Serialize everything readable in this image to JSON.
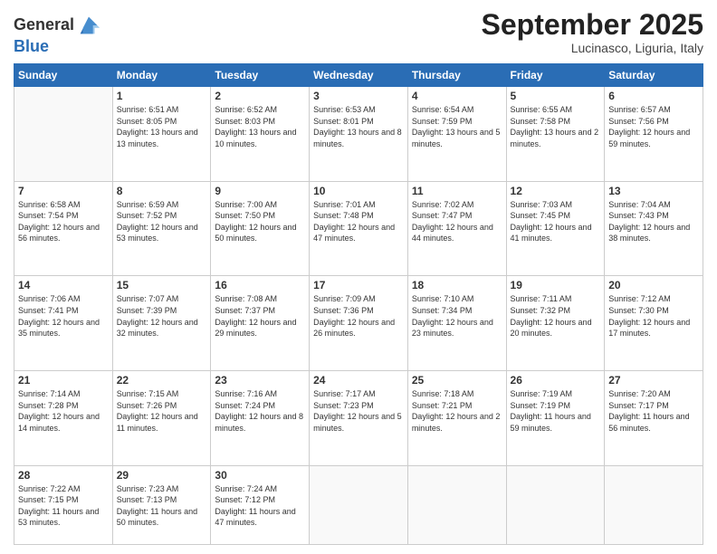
{
  "header": {
    "logo_line1": "General",
    "logo_line2": "Blue",
    "month_title": "September 2025",
    "location": "Lucinasco, Liguria, Italy"
  },
  "weekdays": [
    "Sunday",
    "Monday",
    "Tuesday",
    "Wednesday",
    "Thursday",
    "Friday",
    "Saturday"
  ],
  "weeks": [
    [
      {
        "day": "",
        "sunrise": "",
        "sunset": "",
        "daylight": ""
      },
      {
        "day": "1",
        "sunrise": "Sunrise: 6:51 AM",
        "sunset": "Sunset: 8:05 PM",
        "daylight": "Daylight: 13 hours and 13 minutes."
      },
      {
        "day": "2",
        "sunrise": "Sunrise: 6:52 AM",
        "sunset": "Sunset: 8:03 PM",
        "daylight": "Daylight: 13 hours and 10 minutes."
      },
      {
        "day": "3",
        "sunrise": "Sunrise: 6:53 AM",
        "sunset": "Sunset: 8:01 PM",
        "daylight": "Daylight: 13 hours and 8 minutes."
      },
      {
        "day": "4",
        "sunrise": "Sunrise: 6:54 AM",
        "sunset": "Sunset: 7:59 PM",
        "daylight": "Daylight: 13 hours and 5 minutes."
      },
      {
        "day": "5",
        "sunrise": "Sunrise: 6:55 AM",
        "sunset": "Sunset: 7:58 PM",
        "daylight": "Daylight: 13 hours and 2 minutes."
      },
      {
        "day": "6",
        "sunrise": "Sunrise: 6:57 AM",
        "sunset": "Sunset: 7:56 PM",
        "daylight": "Daylight: 12 hours and 59 minutes."
      }
    ],
    [
      {
        "day": "7",
        "sunrise": "Sunrise: 6:58 AM",
        "sunset": "Sunset: 7:54 PM",
        "daylight": "Daylight: 12 hours and 56 minutes."
      },
      {
        "day": "8",
        "sunrise": "Sunrise: 6:59 AM",
        "sunset": "Sunset: 7:52 PM",
        "daylight": "Daylight: 12 hours and 53 minutes."
      },
      {
        "day": "9",
        "sunrise": "Sunrise: 7:00 AM",
        "sunset": "Sunset: 7:50 PM",
        "daylight": "Daylight: 12 hours and 50 minutes."
      },
      {
        "day": "10",
        "sunrise": "Sunrise: 7:01 AM",
        "sunset": "Sunset: 7:48 PM",
        "daylight": "Daylight: 12 hours and 47 minutes."
      },
      {
        "day": "11",
        "sunrise": "Sunrise: 7:02 AM",
        "sunset": "Sunset: 7:47 PM",
        "daylight": "Daylight: 12 hours and 44 minutes."
      },
      {
        "day": "12",
        "sunrise": "Sunrise: 7:03 AM",
        "sunset": "Sunset: 7:45 PM",
        "daylight": "Daylight: 12 hours and 41 minutes."
      },
      {
        "day": "13",
        "sunrise": "Sunrise: 7:04 AM",
        "sunset": "Sunset: 7:43 PM",
        "daylight": "Daylight: 12 hours and 38 minutes."
      }
    ],
    [
      {
        "day": "14",
        "sunrise": "Sunrise: 7:06 AM",
        "sunset": "Sunset: 7:41 PM",
        "daylight": "Daylight: 12 hours and 35 minutes."
      },
      {
        "day": "15",
        "sunrise": "Sunrise: 7:07 AM",
        "sunset": "Sunset: 7:39 PM",
        "daylight": "Daylight: 12 hours and 32 minutes."
      },
      {
        "day": "16",
        "sunrise": "Sunrise: 7:08 AM",
        "sunset": "Sunset: 7:37 PM",
        "daylight": "Daylight: 12 hours and 29 minutes."
      },
      {
        "day": "17",
        "sunrise": "Sunrise: 7:09 AM",
        "sunset": "Sunset: 7:36 PM",
        "daylight": "Daylight: 12 hours and 26 minutes."
      },
      {
        "day": "18",
        "sunrise": "Sunrise: 7:10 AM",
        "sunset": "Sunset: 7:34 PM",
        "daylight": "Daylight: 12 hours and 23 minutes."
      },
      {
        "day": "19",
        "sunrise": "Sunrise: 7:11 AM",
        "sunset": "Sunset: 7:32 PM",
        "daylight": "Daylight: 12 hours and 20 minutes."
      },
      {
        "day": "20",
        "sunrise": "Sunrise: 7:12 AM",
        "sunset": "Sunset: 7:30 PM",
        "daylight": "Daylight: 12 hours and 17 minutes."
      }
    ],
    [
      {
        "day": "21",
        "sunrise": "Sunrise: 7:14 AM",
        "sunset": "Sunset: 7:28 PM",
        "daylight": "Daylight: 12 hours and 14 minutes."
      },
      {
        "day": "22",
        "sunrise": "Sunrise: 7:15 AM",
        "sunset": "Sunset: 7:26 PM",
        "daylight": "Daylight: 12 hours and 11 minutes."
      },
      {
        "day": "23",
        "sunrise": "Sunrise: 7:16 AM",
        "sunset": "Sunset: 7:24 PM",
        "daylight": "Daylight: 12 hours and 8 minutes."
      },
      {
        "day": "24",
        "sunrise": "Sunrise: 7:17 AM",
        "sunset": "Sunset: 7:23 PM",
        "daylight": "Daylight: 12 hours and 5 minutes."
      },
      {
        "day": "25",
        "sunrise": "Sunrise: 7:18 AM",
        "sunset": "Sunset: 7:21 PM",
        "daylight": "Daylight: 12 hours and 2 minutes."
      },
      {
        "day": "26",
        "sunrise": "Sunrise: 7:19 AM",
        "sunset": "Sunset: 7:19 PM",
        "daylight": "Daylight: 11 hours and 59 minutes."
      },
      {
        "day": "27",
        "sunrise": "Sunrise: 7:20 AM",
        "sunset": "Sunset: 7:17 PM",
        "daylight": "Daylight: 11 hours and 56 minutes."
      }
    ],
    [
      {
        "day": "28",
        "sunrise": "Sunrise: 7:22 AM",
        "sunset": "Sunset: 7:15 PM",
        "daylight": "Daylight: 11 hours and 53 minutes."
      },
      {
        "day": "29",
        "sunrise": "Sunrise: 7:23 AM",
        "sunset": "Sunset: 7:13 PM",
        "daylight": "Daylight: 11 hours and 50 minutes."
      },
      {
        "day": "30",
        "sunrise": "Sunrise: 7:24 AM",
        "sunset": "Sunset: 7:12 PM",
        "daylight": "Daylight: 11 hours and 47 minutes."
      },
      {
        "day": "",
        "sunrise": "",
        "sunset": "",
        "daylight": ""
      },
      {
        "day": "",
        "sunrise": "",
        "sunset": "",
        "daylight": ""
      },
      {
        "day": "",
        "sunrise": "",
        "sunset": "",
        "daylight": ""
      },
      {
        "day": "",
        "sunrise": "",
        "sunset": "",
        "daylight": ""
      }
    ]
  ]
}
